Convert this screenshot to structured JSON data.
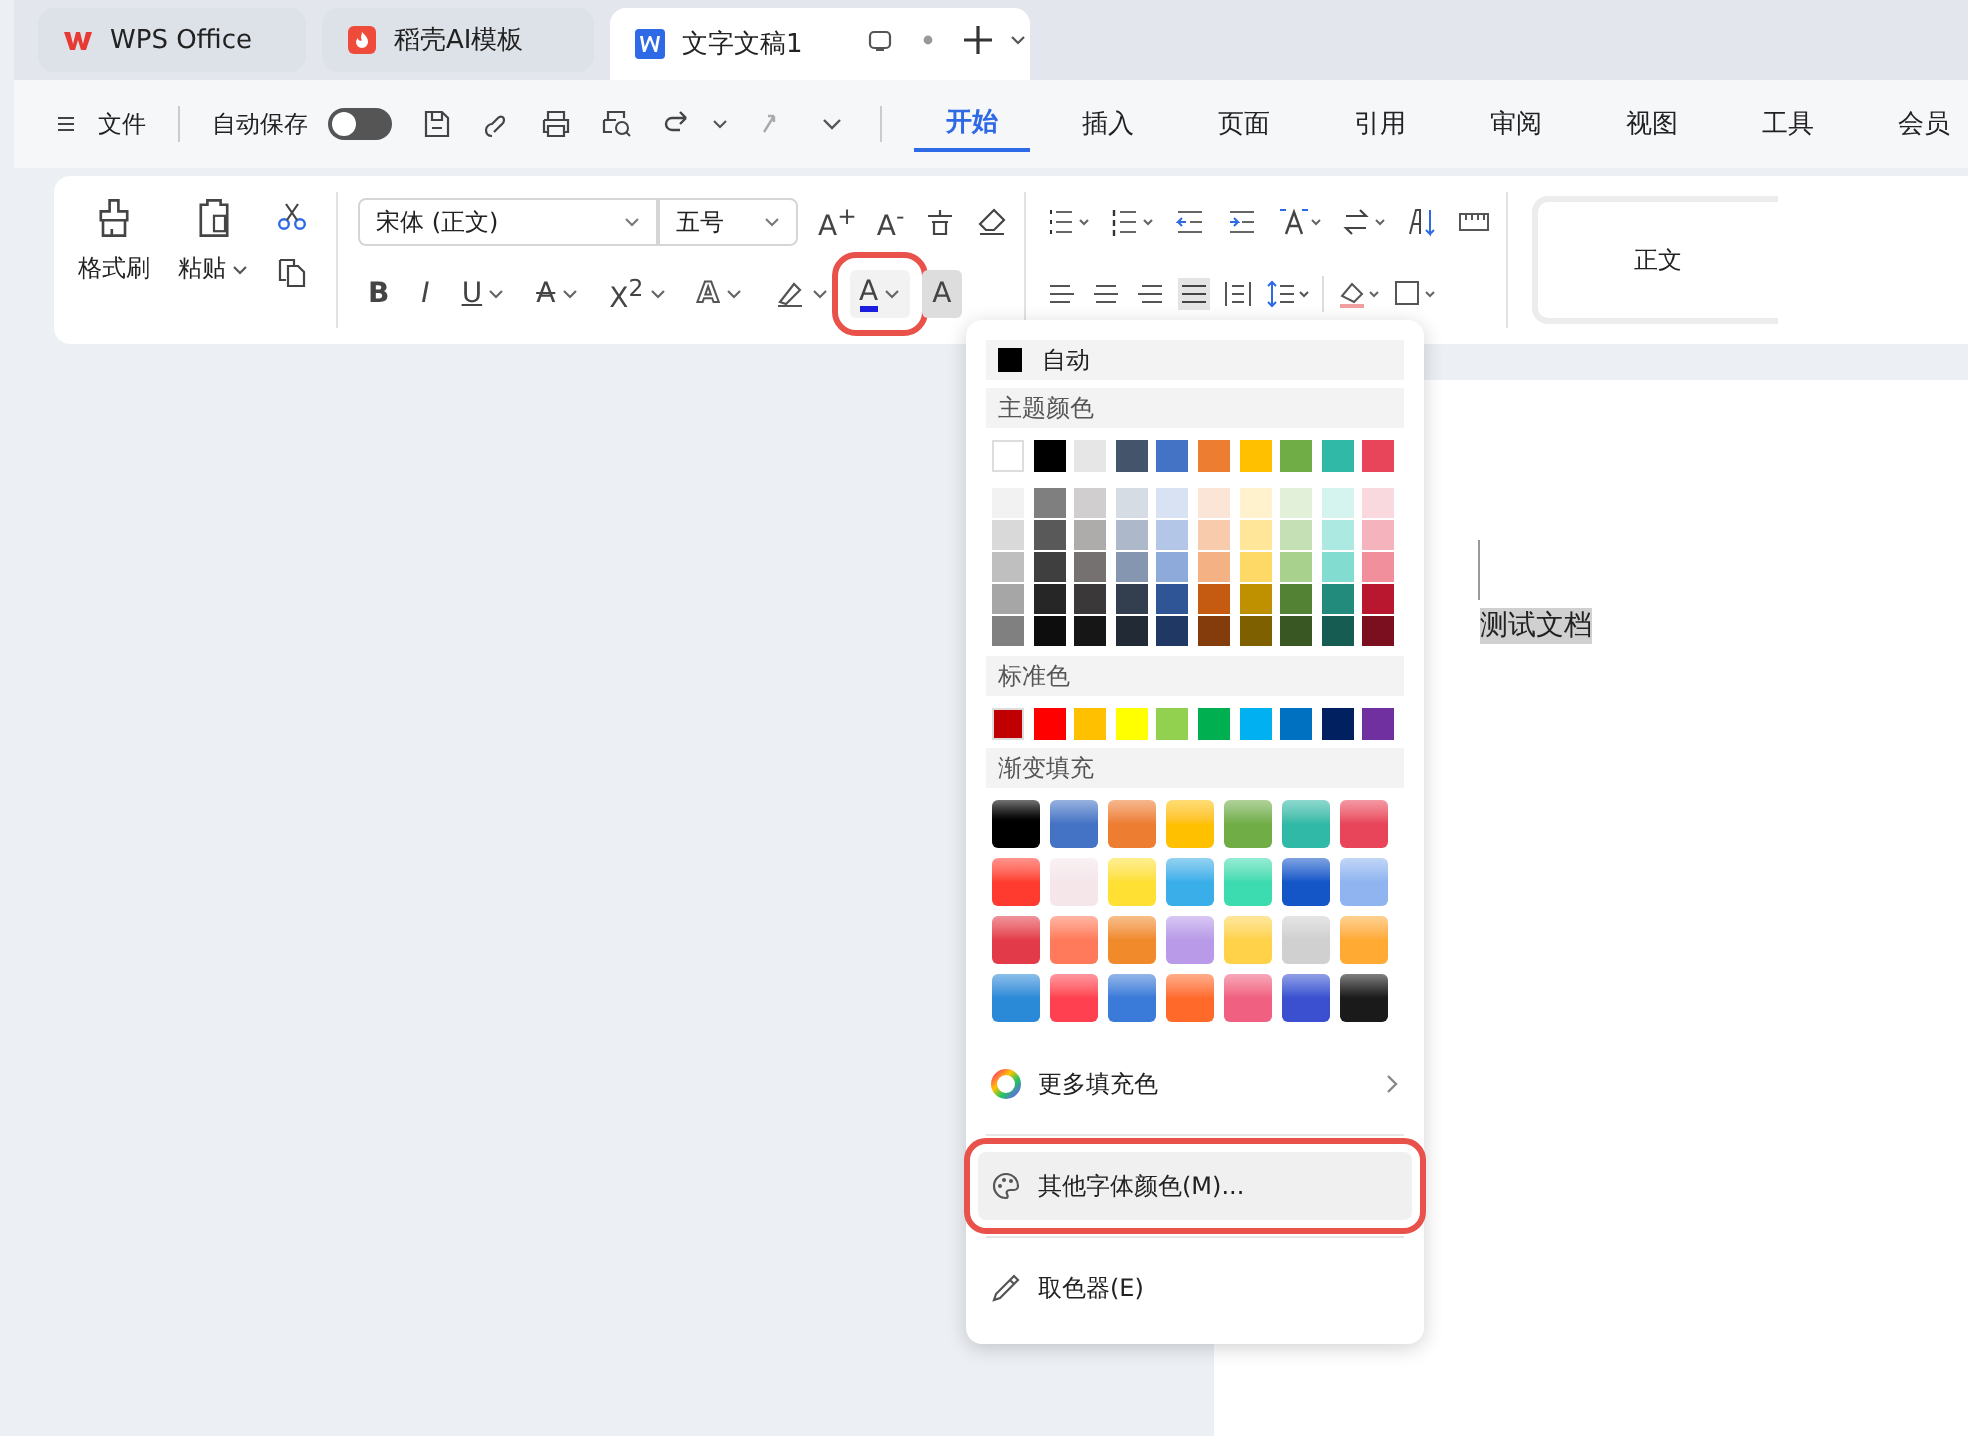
{
  "tabs": [
    {
      "label": "WPS Office",
      "kind": "wps",
      "selected": false
    },
    {
      "label": "稻壳AI模板",
      "kind": "docer",
      "selected": false
    },
    {
      "label": "文字文稿1",
      "kind": "doc",
      "selected": true
    }
  ],
  "menu": {
    "file": "文件",
    "autosave": {
      "label": "自动保存",
      "on": false
    },
    "tabs": [
      {
        "label": "开始",
        "selected": true
      },
      {
        "label": "插入",
        "selected": false
      },
      {
        "label": "页面",
        "selected": false
      },
      {
        "label": "引用",
        "selected": false
      },
      {
        "label": "审阅",
        "selected": false
      },
      {
        "label": "视图",
        "selected": false
      },
      {
        "label": "工具",
        "selected": false
      },
      {
        "label": "会员",
        "selected": false
      }
    ]
  },
  "ribbon": {
    "format_painter": "格式刷",
    "paste": "粘贴",
    "font_name": "宋体 (正文)",
    "font_size": "五号",
    "grow": "A$^{+}$",
    "shrink": "A$^{-}$",
    "format_buttons": [
      {
        "label": "B",
        "kind": "bold",
        "caret": false,
        "highlighted": false
      },
      {
        "label": "I",
        "kind": "italic",
        "caret": false,
        "highlighted": false
      },
      {
        "label": "U",
        "kind": "underline",
        "caret": true,
        "highlighted": false
      },
      {
        "label": "A",
        "kind": "strike",
        "caret": true,
        "highlighted": false
      },
      {
        "label": "X$^{2}$",
        "kind": "plain",
        "caret": true,
        "highlighted": false
      },
      {
        "label": "A",
        "kind": "outline",
        "caret": true,
        "highlighted": false
      },
      {
        "kind": "highlighter",
        "caret": true,
        "highlighted": false
      },
      {
        "label": "A",
        "kind": "fontcolor",
        "caret": true,
        "highlighted": true
      },
      {
        "label": "A",
        "kind": "shaded",
        "caret": false,
        "highlighted": false
      }
    ],
    "style": "正文"
  },
  "document": {
    "text": "测试文档"
  },
  "color_dropdown": {
    "auto": {
      "label": "自动",
      "color": "#000000"
    },
    "theme_heading": "主题颜色",
    "theme": [
      {
        "color": "#ffffff"
      },
      {
        "color": "#000000"
      },
      {
        "color": "#e7e6e6"
      },
      {
        "color": "#44546a"
      },
      {
        "color": "#4472c4"
      },
      {
        "color": "#ed7d31"
      },
      {
        "color": "#ffc000"
      },
      {
        "color": "#70ad47"
      },
      {
        "color": "#2fb9a6"
      },
      {
        "color": "#e8445a"
      }
    ],
    "shades": [
      [
        {
          "color": "#f2f2f2"
        },
        {
          "color": "#7f7f7f"
        },
        {
          "color": "#d0cece"
        },
        {
          "color": "#d6dce4"
        },
        {
          "color": "#d9e2f3"
        },
        {
          "color": "#fbe5d6"
        },
        {
          "color": "#fff2cc"
        },
        {
          "color": "#e2f0d9"
        },
        {
          "color": "#d5f4ef"
        },
        {
          "color": "#fad9de"
        }
      ],
      [
        {
          "color": "#d9d9d9"
        },
        {
          "color": "#595959"
        },
        {
          "color": "#aeabab"
        },
        {
          "color": "#adb9ca"
        },
        {
          "color": "#b4c6e7"
        },
        {
          "color": "#f8cbad"
        },
        {
          "color": "#ffe699"
        },
        {
          "color": "#c5e0b4"
        },
        {
          "color": "#ace9e0"
        },
        {
          "color": "#f5b4bd"
        }
      ],
      [
        {
          "color": "#bfbfbf"
        },
        {
          "color": "#3f3f3f"
        },
        {
          "color": "#757171"
        },
        {
          "color": "#8496b0"
        },
        {
          "color": "#8eaadb"
        },
        {
          "color": "#f4b183"
        },
        {
          "color": "#ffd966"
        },
        {
          "color": "#a9d18e"
        },
        {
          "color": "#82ddd0"
        },
        {
          "color": "#f18f9c"
        }
      ],
      [
        {
          "color": "#a6a6a6"
        },
        {
          "color": "#262626"
        },
        {
          "color": "#3a3838"
        },
        {
          "color": "#333f4f"
        },
        {
          "color": "#2f5597"
        },
        {
          "color": "#c55a11"
        },
        {
          "color": "#bf9000"
        },
        {
          "color": "#548235"
        },
        {
          "color": "#238b7c"
        },
        {
          "color": "#b8172f"
        }
      ],
      [
        {
          "color": "#808080"
        },
        {
          "color": "#0d0d0d"
        },
        {
          "color": "#171616"
        },
        {
          "color": "#222a35"
        },
        {
          "color": "#1f3864"
        },
        {
          "color": "#843c0c"
        },
        {
          "color": "#7f6000"
        },
        {
          "color": "#385723"
        },
        {
          "color": "#175c53"
        },
        {
          "color": "#7b0f1f"
        }
      ]
    ],
    "standard_heading": "标准色",
    "standard": [
      {
        "color": "#c00000"
      },
      {
        "color": "#ff0000"
      },
      {
        "color": "#ffc000"
      },
      {
        "color": "#ffff00"
      },
      {
        "color": "#92d050"
      },
      {
        "color": "#00b050"
      },
      {
        "color": "#00b0f0"
      },
      {
        "color": "#0070c0"
      },
      {
        "color": "#002060"
      },
      {
        "color": "#7030a0"
      }
    ],
    "gradient_heading": "渐变填充",
    "gradients": [
      [
        {
          "color": "#000000"
        },
        {
          "color": "#4472c4"
        },
        {
          "color": "#ed7d31"
        },
        {
          "color": "#ffc000"
        },
        {
          "color": "#70ad47"
        },
        {
          "color": "#2fb9a6"
        },
        {
          "color": "#e8445a"
        }
      ],
      [
        {
          "color": "#ff3b2f"
        },
        {
          "color": "#f5e6ea"
        },
        {
          "color": "#ffe033"
        },
        {
          "color": "#3aaee8"
        },
        {
          "color": "#3ddbb0"
        },
        {
          "color": "#1456c8"
        },
        {
          "color": "#8fb4f0"
        }
      ],
      [
        {
          "color": "#e33a4a"
        },
        {
          "color": "#ff7a5a"
        },
        {
          "color": "#f08a2a"
        },
        {
          "color": "#b89ae8"
        },
        {
          "color": "#ffd24a"
        },
        {
          "color": "#d0d0d0"
        },
        {
          "color": "#ffaa33"
        }
      ],
      [
        {
          "color": "#2a8ad8"
        },
        {
          "color": "#ff4050"
        },
        {
          "color": "#3a7ad8"
        },
        {
          "color": "#ff6a2a"
        },
        {
          "color": "#f06080"
        },
        {
          "color": "#3a50d0"
        },
        {
          "color": "#1a1a1a"
        }
      ]
    ],
    "items": [
      {
        "label": "更多填充色",
        "kind": "more",
        "selected": false
      },
      {
        "label": "其他字体颜色(M)...",
        "kind": "other",
        "selected": true
      },
      {
        "label": "取色器(E)",
        "kind": "picker",
        "selected": false
      }
    ]
  }
}
